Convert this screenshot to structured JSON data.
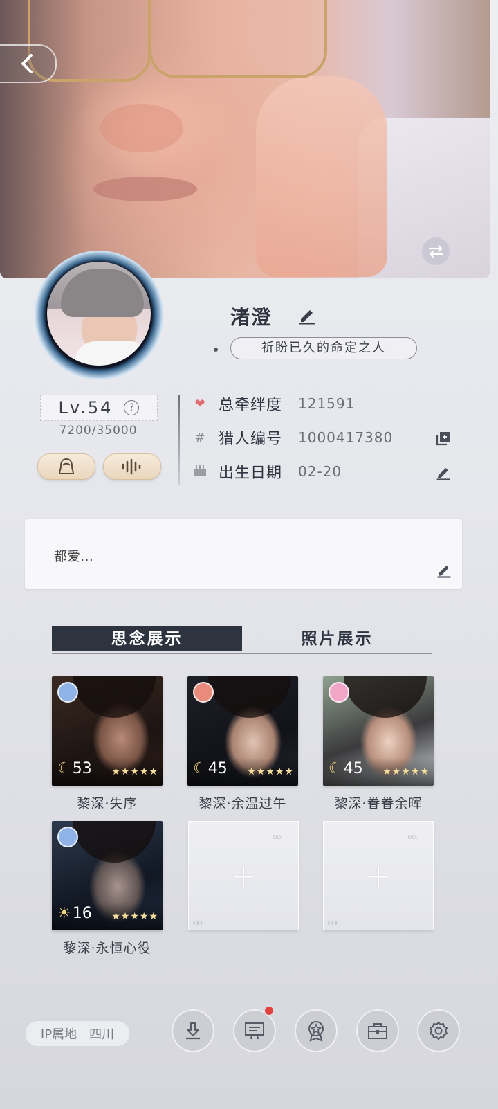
{
  "profile": {
    "name": "渚澄",
    "title": "祈盼已久的命定之人",
    "level": "Lv.54",
    "help_symbol": "?",
    "exp": "7200/35000"
  },
  "info": {
    "bond_label": "总牵绊度",
    "bond_value": "121591",
    "id_label": "猎人编号",
    "id_value": "1000417380",
    "birthday_label": "出生日期",
    "birthday_value": "02-20"
  },
  "signature": {
    "text": "都爱…"
  },
  "tabs": [
    {
      "label": "思念展示"
    },
    {
      "label": "照片展示"
    }
  ],
  "cards": [
    {
      "name": "黎深·失序",
      "level": "53",
      "stars": "★★★★★",
      "badge_color": "#8fb3e6"
    },
    {
      "name": "黎深·余温过午",
      "level": "45",
      "stars": "★★★★★",
      "badge_color": "#e88a7c"
    },
    {
      "name": "黎深·眷眷余晖",
      "level": "45",
      "stars": "★★★★★",
      "badge_color": "#f1a6c8"
    },
    {
      "name": "黎深·永恒心役",
      "level": "16",
      "stars": "★★★★★",
      "badge_color": "#8fb3e6"
    }
  ],
  "empty_slots": {
    "plus": "+"
  },
  "bottom": {
    "ip_label": "IP属地",
    "ip_value": "四川"
  },
  "icons": [
    "back-icon",
    "swap-icon",
    "edit-icon",
    "help-icon",
    "avatar-outline-icon",
    "voice-wave-icon",
    "heart-icon",
    "hash-icon",
    "copy-icon",
    "cake-icon",
    "download-icon",
    "message-board-icon",
    "badge-icon",
    "briefcase-icon",
    "settings-icon"
  ]
}
